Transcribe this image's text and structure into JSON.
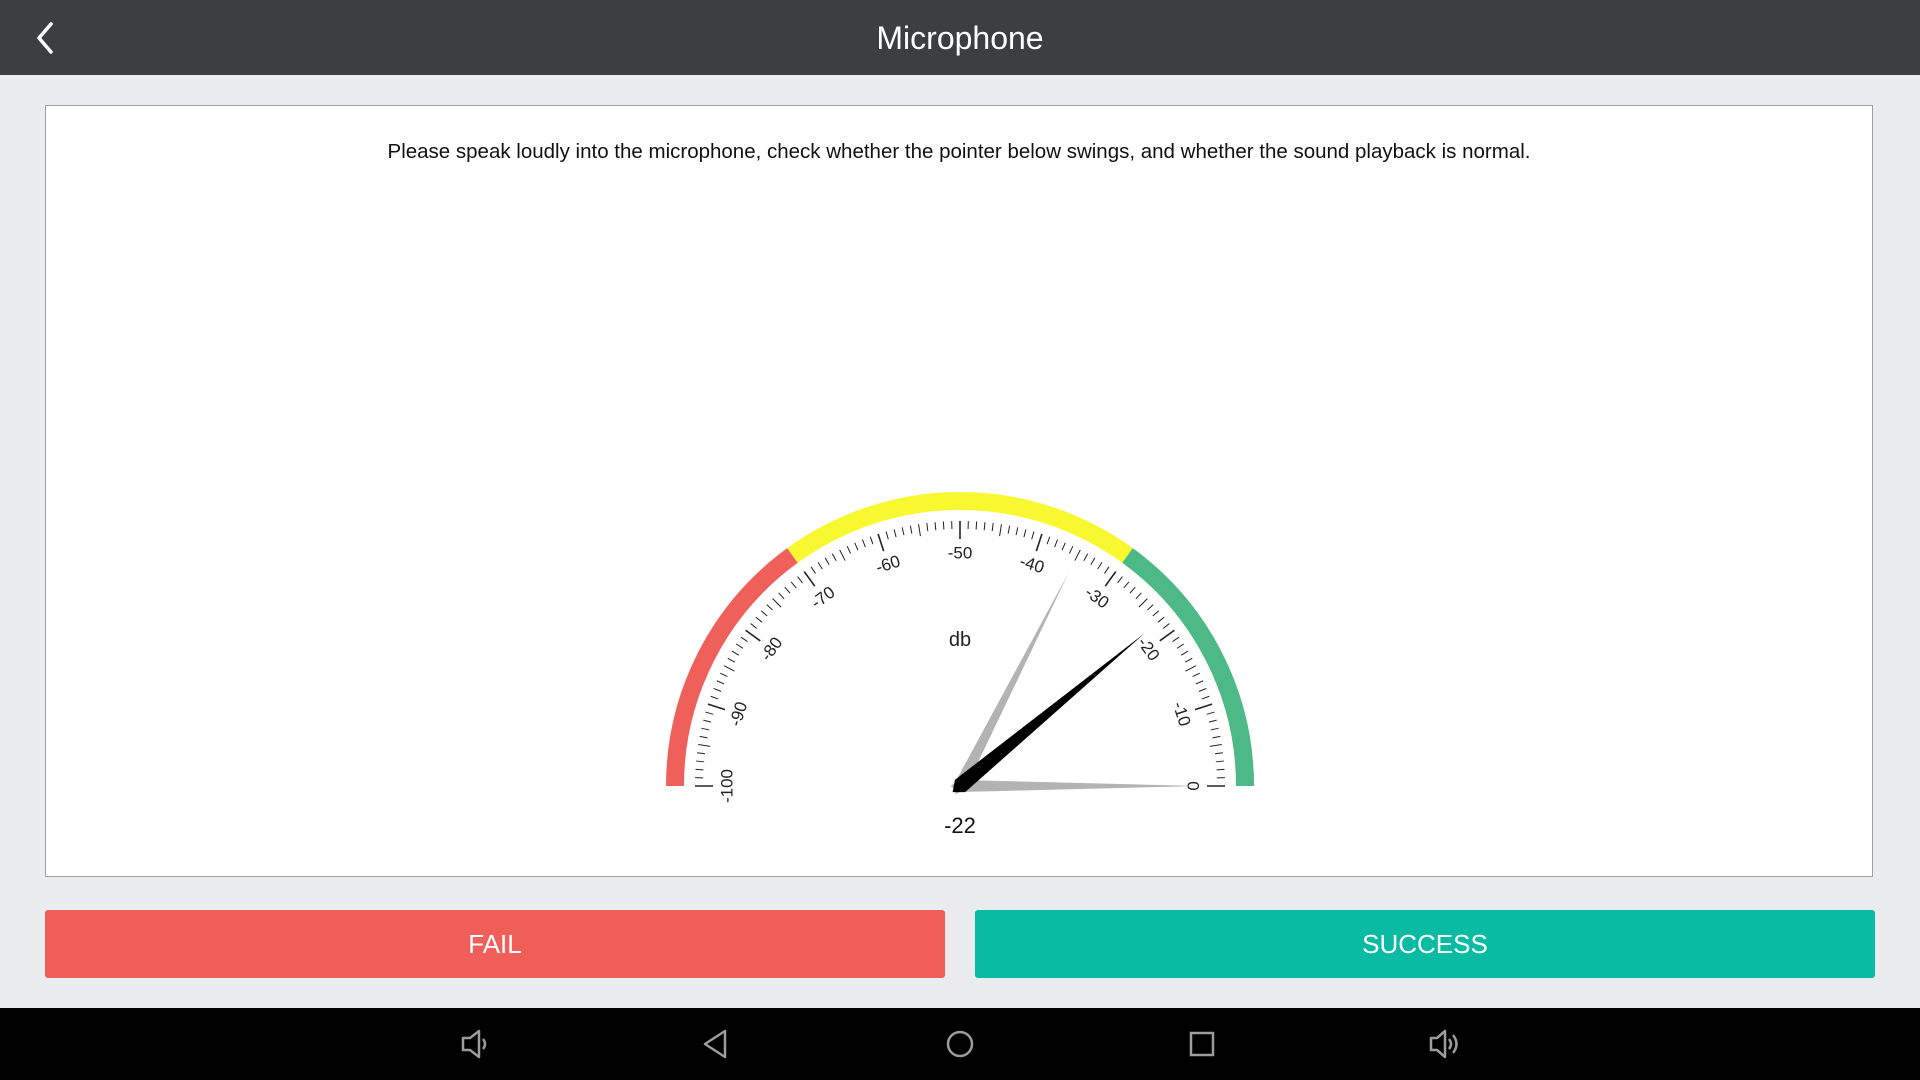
{
  "header": {
    "title": "Microphone",
    "back_icon": "chevron-left-icon"
  },
  "main": {
    "instruction": "Please speak loudly into the microphone, check whether the pointer below swings, and whether the sound playback is normal."
  },
  "gauge": {
    "unit_label": "db",
    "value_text": "-22",
    "value": -22,
    "peak_value": -35,
    "min_value": 0,
    "scale_min": -100,
    "scale_max": 0,
    "tick_labels": [
      "-100",
      "-90",
      "-80",
      "-70",
      "-60",
      "-50",
      "-40",
      "-30",
      "-20",
      "-10",
      "0"
    ],
    "zones": [
      {
        "from": -100,
        "to": -70,
        "color": "#f0605a"
      },
      {
        "from": -70,
        "to": -30,
        "color": "#f8f830"
      },
      {
        "from": -30,
        "to": 0,
        "color": "#4cb987"
      }
    ],
    "needle_color": "#000000",
    "ghost_needle_color": "#b3b3b3"
  },
  "buttons": {
    "fail_label": "FAIL",
    "success_label": "SUCCESS",
    "fail_color": "#f05e59",
    "success_color": "#0abba4"
  },
  "system_nav": {
    "icons": [
      "volume-down-icon",
      "back-icon",
      "home-icon",
      "recents-icon",
      "volume-up-icon"
    ]
  }
}
